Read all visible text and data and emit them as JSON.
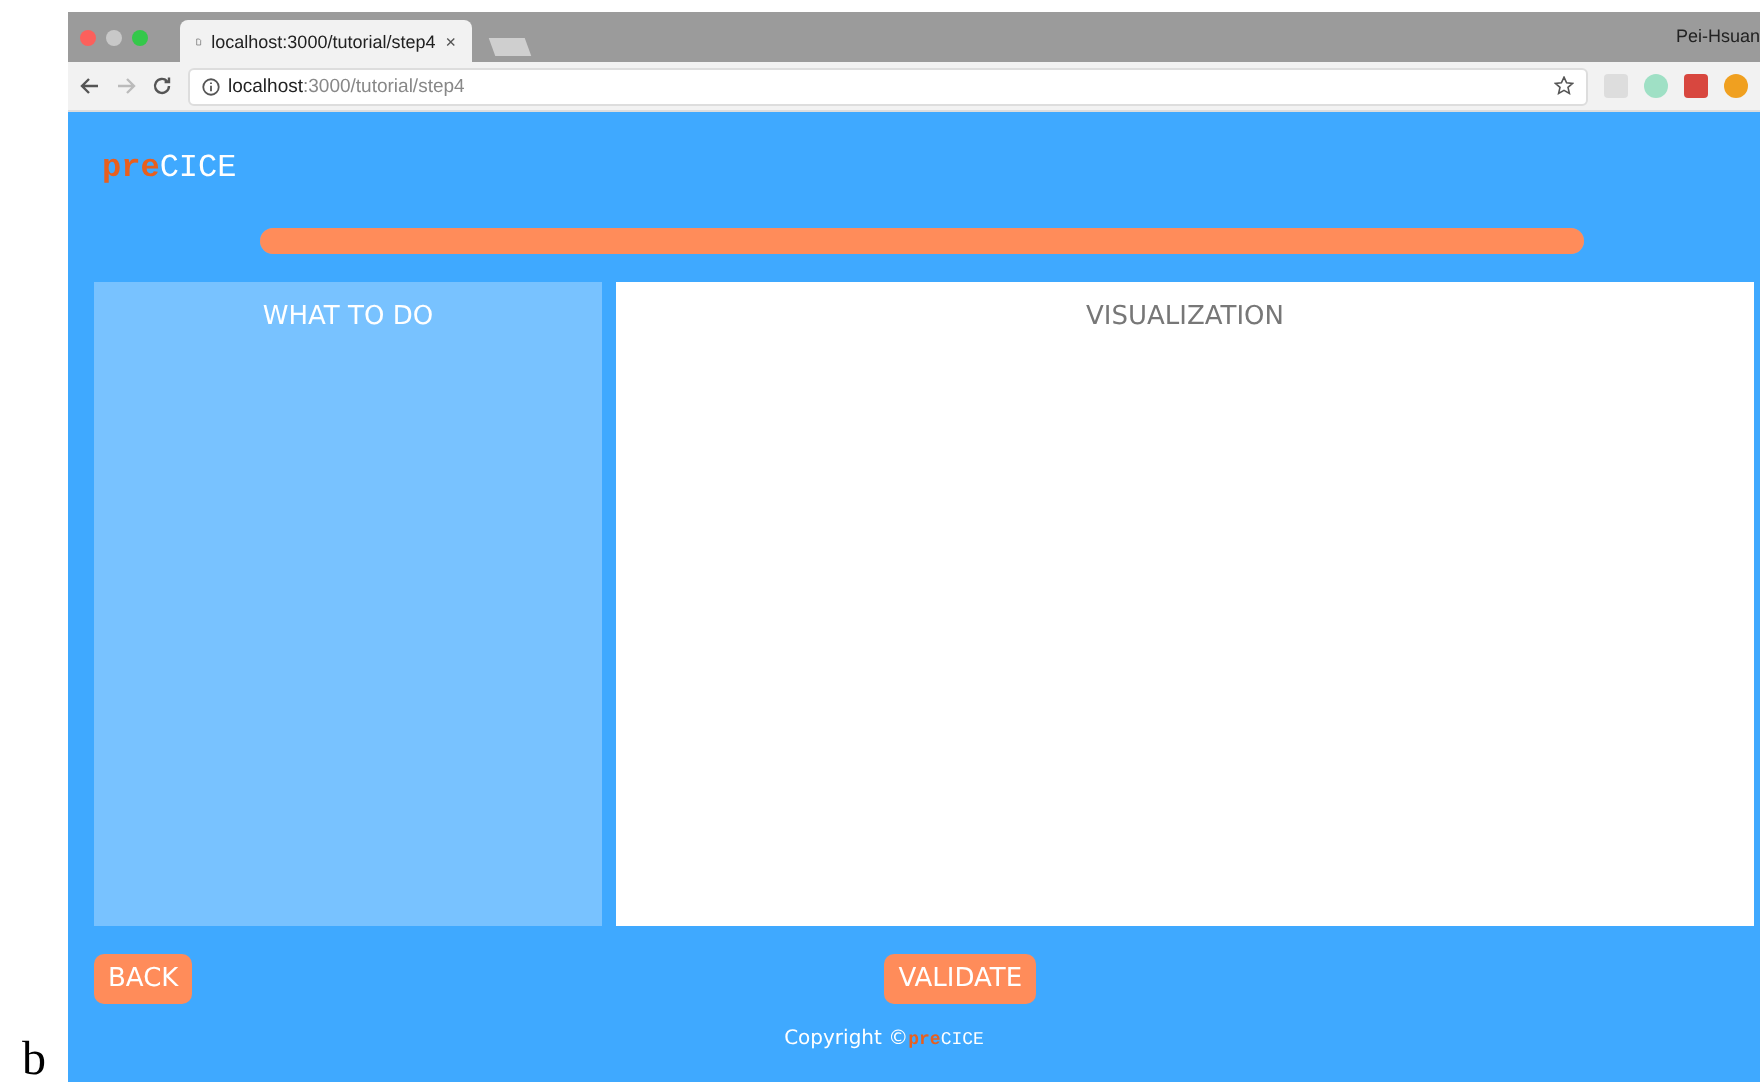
{
  "figure_label": "b",
  "browser": {
    "tab_title": "localhost:3000/tutorial/step4",
    "tab_close": "×",
    "user": "Pei-Hsuan",
    "address_host": "localhost",
    "address_rest": ":3000/tutorial/step4"
  },
  "header": {
    "logo_prefix": "pre",
    "logo_name": "CICE"
  },
  "progress": {
    "level": 1
  },
  "panels": [
    {
      "kind": "instructions",
      "title": "WHAT TO DO"
    },
    {
      "kind": "visualization",
      "title": "VISUALIZATION"
    }
  ],
  "buttons": [
    {
      "label": "BACK"
    },
    {
      "label": "VALIDATE"
    }
  ],
  "footer": {
    "text": "Copyright ©",
    "brand_prefix": "pre",
    "brand_name": "CICE"
  }
}
